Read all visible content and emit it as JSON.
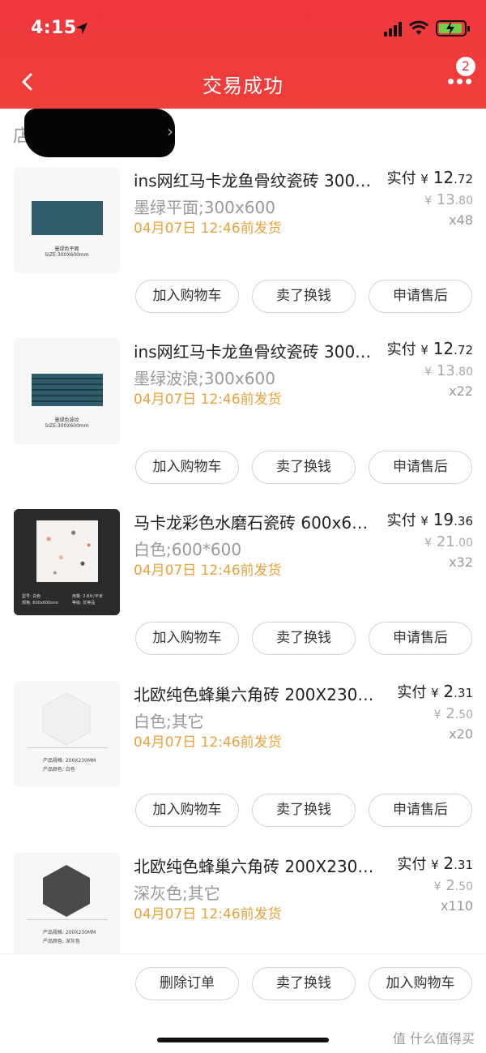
{
  "status": {
    "time": "4:15"
  },
  "header": {
    "title": "交易成功",
    "badge_count": "2"
  },
  "items": [
    {
      "name": "ins网红马卡龙鱼骨纹瓷砖 300…",
      "spec": "墨绿平面;300x600",
      "ship": "04月07日 12:46前发货",
      "paid_label": "实付",
      "paid_currency": "¥",
      "paid_int": "12",
      "paid_dec": ".72",
      "orig_currency": "¥",
      "orig_int": "13",
      "orig_dec": ".80",
      "qty": "x48",
      "thumb_caption1": "墨绿色平面",
      "thumb_caption2": "SIZE:300X600mm",
      "buttons": [
        "加入购物车",
        "卖了换钱",
        "申请售后"
      ]
    },
    {
      "name": "ins网红马卡龙鱼骨纹瓷砖 300…",
      "spec": "墨绿波浪;300x600",
      "ship": "04月07日 12:46前发货",
      "paid_label": "实付",
      "paid_currency": "¥",
      "paid_int": "12",
      "paid_dec": ".72",
      "orig_currency": "¥",
      "orig_int": "13",
      "orig_dec": ".80",
      "qty": "x22",
      "thumb_caption1": "墨绿色波纹",
      "thumb_caption2": "SIZE:300X600mm",
      "buttons": [
        "加入购物车",
        "卖了换钱",
        "申请售后"
      ]
    },
    {
      "name": "马卡龙彩色水磨石瓷砖 600x6…",
      "spec": "白色;600*600",
      "ship": "04月07日 12:46前发货",
      "paid_label": "实付",
      "paid_currency": "¥",
      "paid_int": "19",
      "paid_dec": ".36",
      "orig_currency": "¥",
      "orig_int": "21",
      "orig_dec": ".00",
      "qty": "x32",
      "thumb_caption1": "型号: 白色",
      "thumb_caption2": "规格: 600x600mm",
      "thumb_caption3": "用量: 2.8片/平米",
      "thumb_caption4": "等级: 优等品",
      "buttons": [
        "加入购物车",
        "卖了换钱",
        "申请售后"
      ]
    },
    {
      "name": "北欧纯色蜂巢六角砖 200X230 …",
      "spec": "白色;其它",
      "ship": "04月07日 12:46前发货",
      "paid_label": "实付",
      "paid_currency": "¥",
      "paid_int": "2",
      "paid_dec": ".31",
      "orig_currency": "¥",
      "orig_int": "2",
      "orig_dec": ".50",
      "qty": "x20",
      "thumb_caption1": "产品规格: 200X230MM",
      "thumb_caption2": "产品颜色: 白色",
      "buttons": [
        "加入购物车",
        "卖了换钱",
        "申请售后"
      ]
    },
    {
      "name": "北欧纯色蜂巢六角砖 200X230 …",
      "spec": "深灰色;其它",
      "ship": "04月07日 12:46前发货",
      "paid_label": "实付",
      "paid_currency": "¥",
      "paid_int": "2",
      "paid_dec": ".31",
      "orig_currency": "¥",
      "orig_int": "2",
      "orig_dec": ".50",
      "qty": "x110",
      "thumb_caption1": "产品规格: 200X230MM",
      "thumb_caption2": "产品颜色: 深灰色",
      "buttons": []
    }
  ],
  "bottom_bar": {
    "buttons": [
      "删除订单",
      "卖了换钱",
      "加入购物车"
    ]
  },
  "watermark": "值 什么值得买",
  "colors": {
    "header_red": "#f0373d",
    "ship_orange": "#e8a23a",
    "tile_green": "#2f5d6b"
  }
}
